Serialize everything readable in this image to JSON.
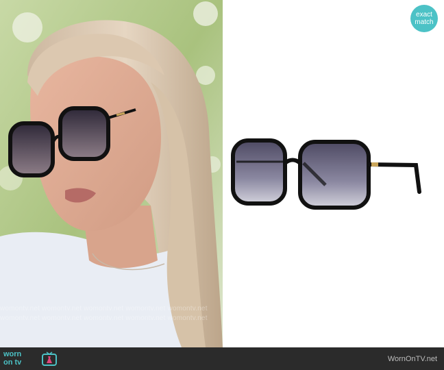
{
  "badge": {
    "line1": "exact",
    "line2": "match"
  },
  "watermark": {
    "text": "womontv.net  womontv.net  womontv.net  womontv.net  womontv.net"
  },
  "footer": {
    "logo_line1": "worn",
    "logo_line2": "on tv",
    "site": "WornOnTV.net"
  },
  "colors": {
    "accent": "#4cc2c6",
    "footer_bg": "#2b2b2b",
    "lens": "#5a5870",
    "frame": "#111111",
    "temple_tip": "#c9a55a"
  }
}
